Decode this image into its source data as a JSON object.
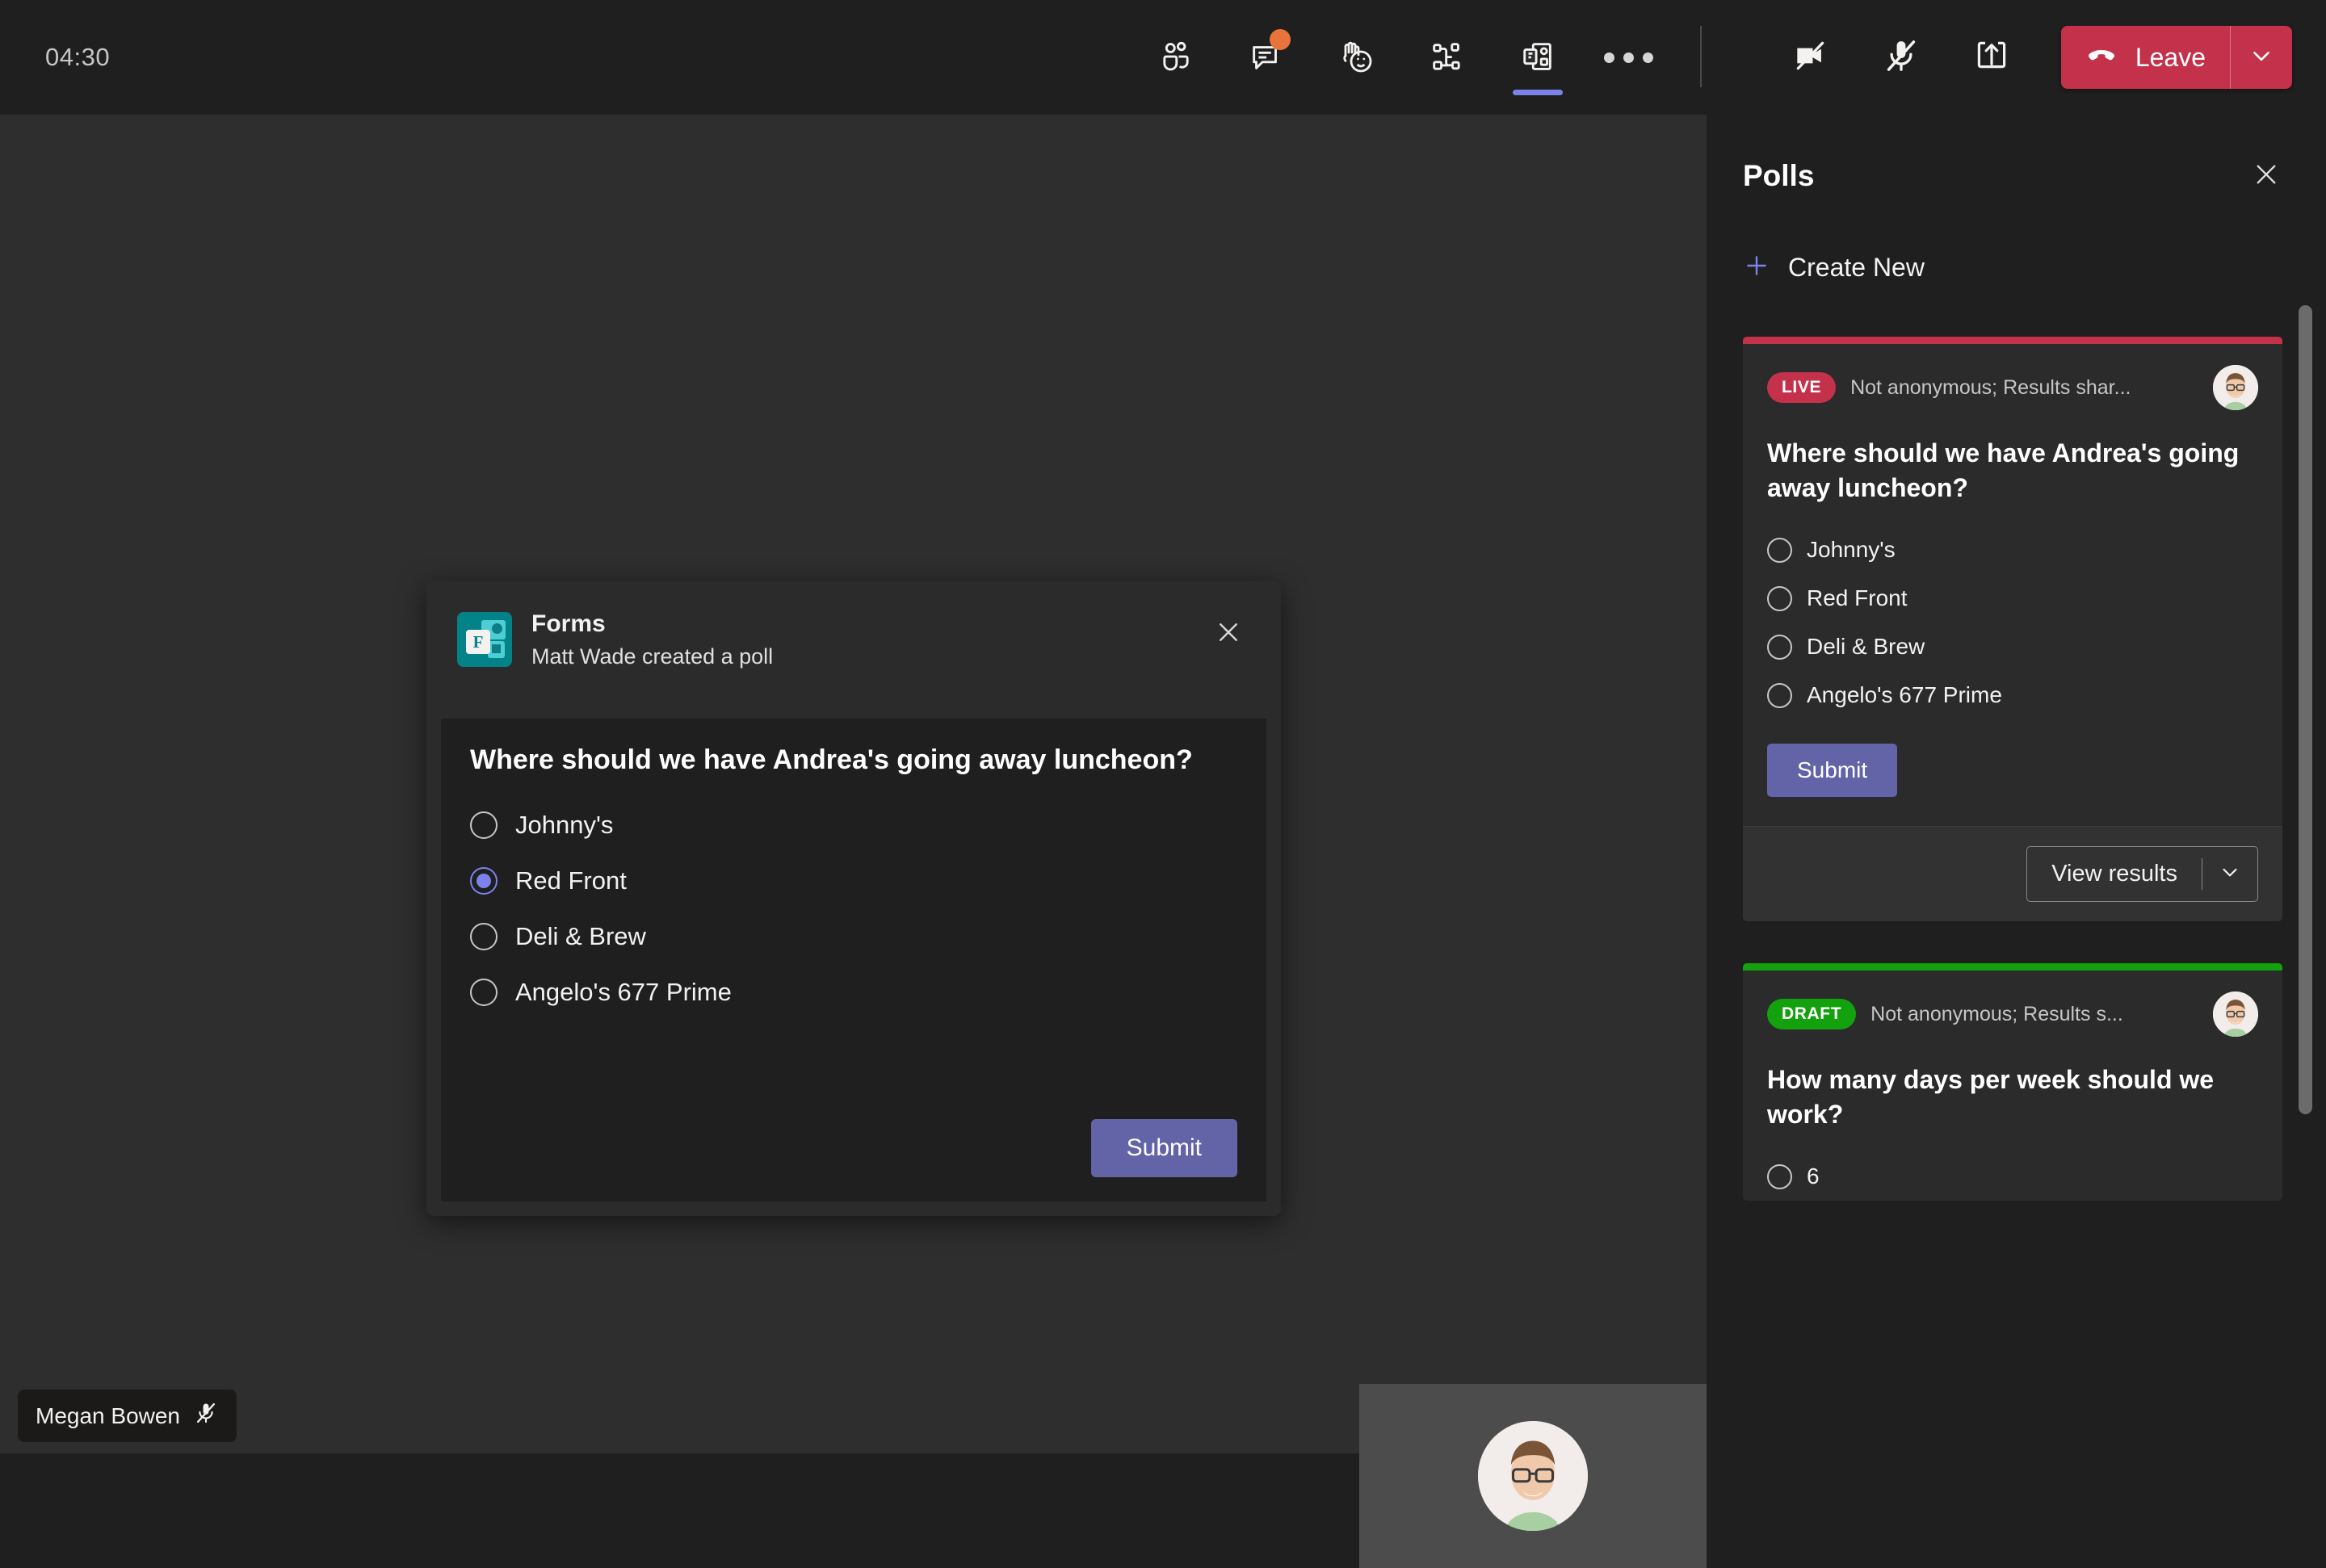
{
  "topbar": {
    "timer": "04:30",
    "tools": [
      {
        "name": "people-icon",
        "label": "People"
      },
      {
        "name": "chat-icon",
        "label": "Chat",
        "badge": true
      },
      {
        "name": "raise-hand-icon",
        "label": "Reactions"
      },
      {
        "name": "breakout-rooms-icon",
        "label": "Breakout rooms"
      },
      {
        "name": "forms-app-icon",
        "label": "Forms",
        "active": true
      },
      {
        "name": "more-options-icon",
        "label": "More actions"
      }
    ],
    "right": [
      {
        "name": "camera-off-icon",
        "label": "Camera off"
      },
      {
        "name": "mic-off-icon",
        "label": "Mic off"
      },
      {
        "name": "share-screen-icon",
        "label": "Share content"
      }
    ],
    "leave_label": "Leave"
  },
  "stage": {
    "self_name": "Megan Bowen",
    "self_muted": true
  },
  "modal": {
    "app_title": "Forms",
    "subtitle": "Matt Wade created a poll",
    "question": "Where should we have Andrea's going away luncheon?",
    "options": [
      {
        "label": "Johnny's",
        "selected": false
      },
      {
        "label": "Red Front",
        "selected": true
      },
      {
        "label": "Deli & Brew",
        "selected": false
      },
      {
        "label": "Angelo's 677 Prime",
        "selected": false
      }
    ],
    "submit_label": "Submit"
  },
  "panel": {
    "title": "Polls",
    "create_new_label": "Create New",
    "polls": [
      {
        "status": "LIVE",
        "status_color": "#c4314b",
        "meta": "Not anonymous; Results shar...",
        "question": "Where should we have Andrea's going away luncheon?",
        "options": [
          "Johnny's",
          "Red Front",
          "Deli & Brew",
          "Angelo's 677 Prime"
        ],
        "submit_label": "Submit",
        "footer_label": "View results"
      },
      {
        "status": "DRAFT",
        "status_color": "#13a10e",
        "meta": "Not anonymous; Results s...",
        "question": "How many days per week should we work?",
        "options": [
          "6"
        ]
      }
    ]
  },
  "colors": {
    "accent_purple": "#6264a7",
    "accent_light_purple": "#7b83eb",
    "live_red": "#c4314b",
    "draft_green": "#13a10e",
    "forms_teal": "#038387",
    "badge_orange": "#e8733b"
  }
}
